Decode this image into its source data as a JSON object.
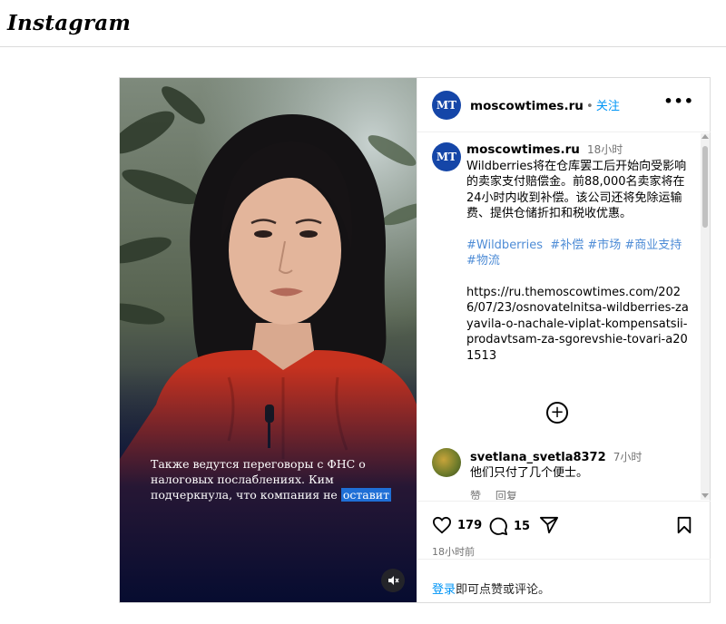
{
  "app": {
    "logo": "Instagram"
  },
  "post": {
    "account": "moscowtimes.ru",
    "avatar_text": "MT",
    "follow_label": "关注",
    "more_label": "•••",
    "caption": {
      "username": "moscowtimes.ru",
      "time": "18小时",
      "text": "Wildberries将在仓库罢工后开始向受影响的卖家支付赔偿金。前88,000名卖家将在24小时内收到补偿。该公司还将免除运输费、提供仓储折扣和税收优惠。",
      "tags": [
        "#Wildberries",
        "#补偿",
        "#市场",
        "#商业支持",
        "#物流"
      ],
      "link": "https://ru.themoscowtimes.com/2026/07/23/osnovatelnitsa-wildberries-zayavila-o-nachale-viplat-kompensatsii-prodavtsam-za-sgorevshie-tovari-a201513"
    },
    "load_more_symbol": "+",
    "comment": {
      "username": "svetlana_svetla8372",
      "time": "7小时",
      "text": "他们只付了几个便士。",
      "like_label": "赞",
      "reply_label": "回复"
    },
    "likes": "179",
    "comments_count": "15",
    "posted_ago": "18小时前",
    "footer": {
      "login_link": "登录",
      "login_rest": "即可点赞或评论。"
    },
    "video": {
      "subtitle_main": "Также ведутся переговоры с ФНС о налоговых послаблениях. Ким подчеркнула, что компания не",
      "subtitle_highlight": "оставит"
    }
  },
  "colors": {
    "accent": "#0095f6",
    "avatar_bg": "#1546a8",
    "subtitle_highlight": "#1f6fd6"
  },
  "icons": [
    "heart-icon",
    "comment-icon",
    "share-icon",
    "bookmark-icon",
    "mute-icon",
    "more-icon",
    "add-circle-icon"
  ]
}
